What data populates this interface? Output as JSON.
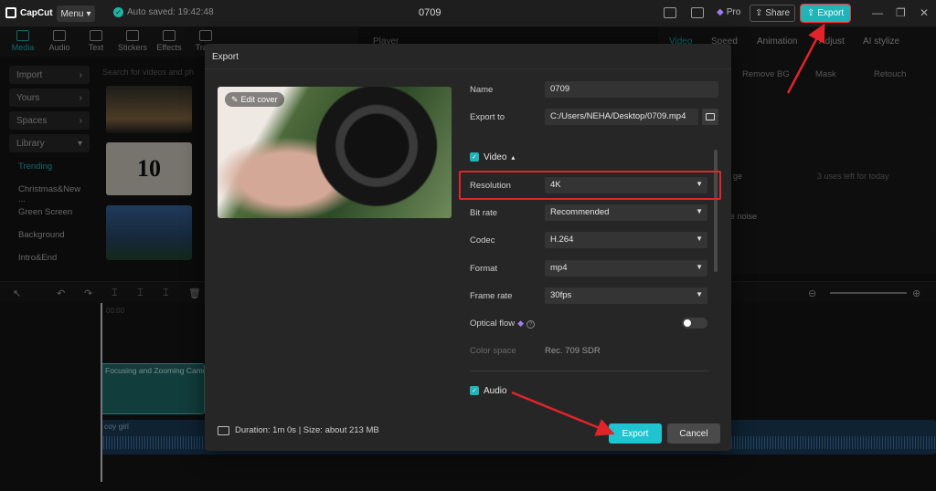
{
  "titlebar": {
    "app_name": "CapCut",
    "menu_label": "Menu",
    "autosave_text": "Auto saved: 19:42:48",
    "project_title": "0709",
    "pro_label": "Pro",
    "share_label": "Share",
    "export_label": "Export"
  },
  "toolbar": {
    "items": [
      {
        "label": "Media",
        "icon": "media-icon"
      },
      {
        "label": "Audio",
        "icon": "audio-icon"
      },
      {
        "label": "Text",
        "icon": "text-icon"
      },
      {
        "label": "Stickers",
        "icon": "stickers-icon"
      },
      {
        "label": "Effects",
        "icon": "effects-icon"
      },
      {
        "label": "Trans",
        "icon": "transitions-icon"
      }
    ]
  },
  "left_nav": {
    "import": "Import",
    "yours": "Yours",
    "spaces": "Spaces",
    "library": "Library",
    "trending": "Trending",
    "christmas": "Christmas&New ...",
    "green_screen": "Green Screen",
    "background": "Background",
    "intro_end": "Intro&End"
  },
  "media": {
    "search_placeholder": "Search for videos and ph",
    "thumb2_text": "10"
  },
  "player": {
    "label": "Player"
  },
  "right_panel": {
    "tabs": [
      "Video",
      "Speed",
      "Animation",
      "Adjust",
      "AI stylize"
    ],
    "subtabs": [
      "Remove BG",
      "Mask",
      "Retouch"
    ],
    "uses_left": "3 uses left for today",
    "row1": "ge",
    "row2": "ge noise"
  },
  "timeline": {
    "time_start": "00:00",
    "video_clip_label": "Focusing and Zooming Camera",
    "audio_clip_label": "coy girl"
  },
  "dialog": {
    "title": "Export",
    "edit_cover": "Edit cover",
    "name_label": "Name",
    "name_value": "0709",
    "export_to_label": "Export to",
    "export_to_value": "C:/Users/NEHA/Desktop/0709.mp4",
    "video_section": "Video",
    "resolution_label": "Resolution",
    "resolution_value": "4K",
    "bitrate_label": "Bit rate",
    "bitrate_value": "Recommended",
    "codec_label": "Codec",
    "codec_value": "H.264",
    "format_label": "Format",
    "format_value": "mp4",
    "framerate_label": "Frame rate",
    "framerate_value": "30fps",
    "optical_flow_label": "Optical flow",
    "color_space_label": "Color space",
    "color_space_value": "Rec. 709 SDR",
    "audio_section": "Audio",
    "duration_text": "Duration: 1m 0s | Size: about 213 MB",
    "export_button": "Export",
    "cancel_button": "Cancel"
  },
  "colors": {
    "accent": "#20b3b8",
    "highlight": "#e0242a",
    "premium": "#a07cf3"
  }
}
